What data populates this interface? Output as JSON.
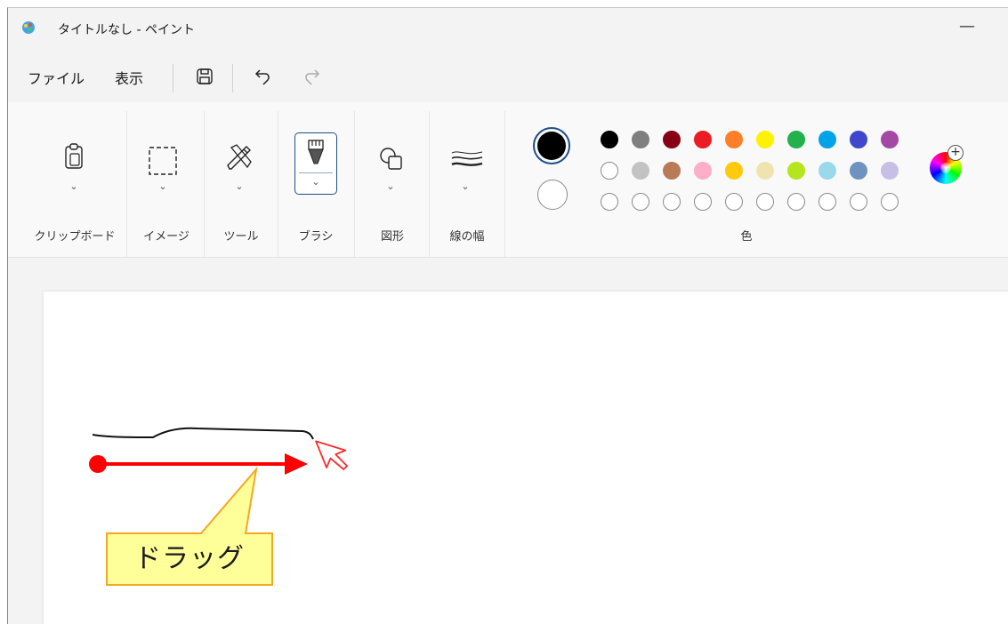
{
  "window": {
    "title": "タイトルなし - ペイント",
    "minimize_glyph": "—"
  },
  "menu": {
    "file": "ファイル",
    "view": "表示"
  },
  "ribbon": {
    "groups": [
      {
        "label": "クリップボード",
        "icon": "clipboard-icon"
      },
      {
        "label": "イメージ",
        "icon": "select-icon"
      },
      {
        "label": "ツール",
        "icon": "tools-icon"
      },
      {
        "label": "ブラシ",
        "icon": "brush-icon"
      },
      {
        "label": "図形",
        "icon": "shapes-icon"
      },
      {
        "label": "線の幅",
        "icon": "line-width-icon"
      },
      {
        "label": "色",
        "icon": "palette"
      }
    ],
    "chevron": "⌄"
  },
  "colors": {
    "primary": "#000000",
    "secondary": "#ffffff",
    "row1": [
      "#000000",
      "#7f7f7f",
      "#880015",
      "#ed1c24",
      "#ff7f27",
      "#fff200",
      "#22b14c",
      "#00a2e8",
      "#3f48cc",
      "#a349a4"
    ],
    "row2": [
      "#ffffff",
      "#c3c3c3",
      "#b97a57",
      "#ffaec9",
      "#ffc90e",
      "#efe4b0",
      "#b5e61d",
      "#99d9ea",
      "#7092be",
      "#c8bfe7"
    ],
    "row3": [
      "#ffffff",
      "#ffffff",
      "#ffffff",
      "#ffffff",
      "#ffffff",
      "#ffffff",
      "#ffffff",
      "#ffffff",
      "#ffffff",
      "#ffffff"
    ],
    "wheel_plus": "+"
  },
  "annotation": {
    "callout": "ドラッグ",
    "arrow_color": "#ff0000",
    "callout_fill": "#ffff99",
    "callout_border": "#f5a623"
  }
}
